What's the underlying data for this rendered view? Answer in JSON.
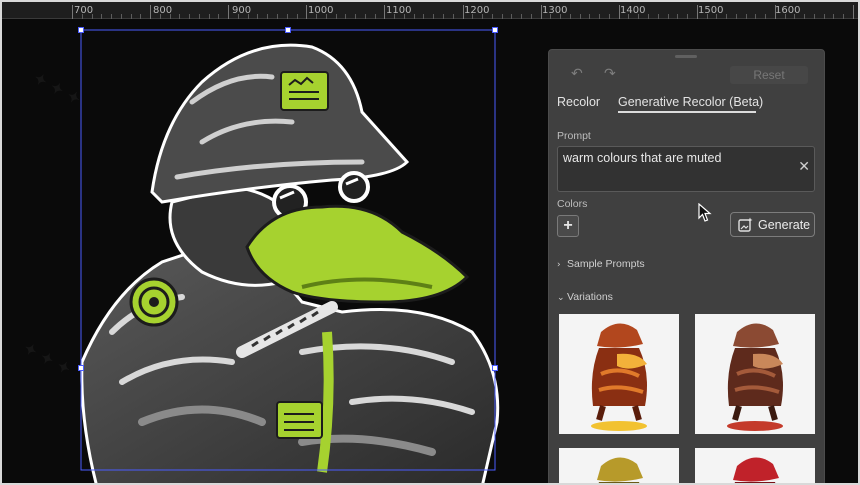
{
  "ruler": {
    "labels": [
      "700",
      "800",
      "900",
      "1000",
      "1100",
      "1200",
      "1300",
      "1400",
      "1500",
      "1600"
    ]
  },
  "panel": {
    "undo_icon": "undo-icon",
    "redo_icon": "redo-icon",
    "reset_label": "Reset",
    "tabs": [
      {
        "label": "Recolor"
      },
      {
        "label": "Generative Recolor (Beta)"
      }
    ],
    "prompt": {
      "label": "Prompt",
      "value": "warm colours that are muted"
    },
    "colors": {
      "label": "Colors"
    },
    "generate_label": "Generate",
    "sample_prompts_label": "Sample Prompts",
    "variations_label": "Variations"
  },
  "colors": {
    "accent_lime": "#a6d22f",
    "panel_bg": "#404040",
    "selection": "#4a5cff"
  }
}
